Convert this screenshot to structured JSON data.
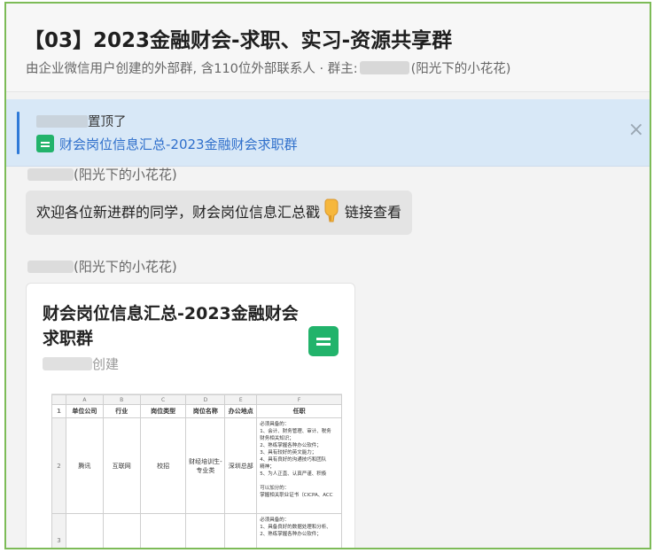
{
  "header": {
    "title": "【03】2023金融财会-求职、实习-资源共享群",
    "subtitle_prefix": "由企业微信用户创建的外部群, 含110位外部联系人 · 群主:",
    "subtitle_suffix": "(阳光下的小花花)"
  },
  "pinned": {
    "label": "置顶了",
    "doc_title": "财会岗位信息汇总-2023金融财会求职群",
    "close": "×"
  },
  "messages": [
    {
      "sender_suffix": "(阳光下的小花花)",
      "text_before": "欢迎各位新进群的同学，财会岗位信息汇总戳",
      "text_after": "链接查看"
    },
    {
      "sender_suffix": "(阳光下的小花花)",
      "card": {
        "title": "财会岗位信息汇总-2023金融财会求职群",
        "creator_suffix": "创建"
      }
    }
  ],
  "sheet_preview": {
    "col_letters": [
      "A",
      "B",
      "C",
      "D",
      "E",
      "F"
    ],
    "headers": [
      "",
      "单位公司",
      "行业",
      "岗位类型",
      "岗位名称",
      "办公地点",
      "任职"
    ],
    "row_numbers": [
      "1",
      "2",
      "3"
    ],
    "row1": [
      "腾讯",
      "互联网",
      "校招",
      "财经培训生-专业类",
      "深圳总部"
    ],
    "requirements_1": [
      "必须具备的：",
      "1、会计、财务管理、审计、税务",
      "财务相关知识；",
      "2、熟练掌握各种办公软件；",
      "3、具有较好的英文能力；",
      "4、具有良好的沟通技巧和团队",
      "精神；",
      "5、为人正直、认真严谨、积极",
      "",
      "可以加分的：",
      "掌握相关职业证书（CICPA、ACC"
    ],
    "requirements_2": [
      "必须具备的：",
      "1、具备良好的数据处理和分析、",
      "2、熟练掌握各种办公软件；"
    ]
  },
  "colors": {
    "accent_green": "#7dbb57",
    "pinned_bg": "#d8e8f7",
    "link_blue": "#2f6fcb",
    "sheet_green": "#22b36b"
  },
  "icons": {
    "sheet": "sheet-icon",
    "close": "close-icon",
    "hand": "pointing-down-hand-icon"
  }
}
